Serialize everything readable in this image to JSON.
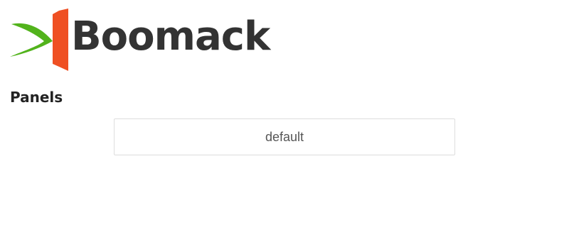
{
  "brand": {
    "name": "Boomack",
    "logo_icon": "boomack-logo-icon",
    "colors": {
      "green": "#52b31c",
      "orange": "#ef5023",
      "text": "#333333"
    }
  },
  "panels_section": {
    "title": "Panels",
    "items": [
      {
        "label": "default"
      }
    ]
  }
}
